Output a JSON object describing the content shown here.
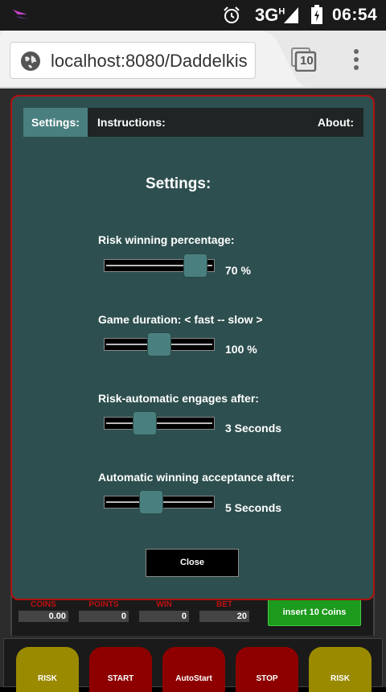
{
  "status_bar": {
    "network": "3G",
    "network_sup": "H",
    "time": "06:54",
    "icons": [
      "app-notification-icon",
      "alarm-icon",
      "signal-icon",
      "battery-charging-icon"
    ]
  },
  "browser": {
    "url": "localhost:8080/Daddelkis",
    "tab_count": "10",
    "icons": [
      "globe-icon",
      "tabs-icon",
      "overflow-menu-icon"
    ]
  },
  "dialog": {
    "nav": {
      "settings": "Settings:",
      "instructions": "Instructions:",
      "about": "About:"
    },
    "title": "Settings:",
    "settings": [
      {
        "label": "Risk winning percentage:",
        "value": "70 %",
        "slider_fraction": 0.92
      },
      {
        "label": "Game duration: < fast -- slow >",
        "value": "100 %",
        "slider_fraction": 0.5
      },
      {
        "label": "Risk-automatic engages after:",
        "value": "3 Seconds",
        "slider_fraction": 0.33
      },
      {
        "label": "Automatic winning acceptance after:",
        "value": "5 Seconds",
        "slider_fraction": 0.41
      }
    ],
    "close_label": "Close"
  },
  "stats": {
    "coins_label": "COINS",
    "coins_value": "0.00",
    "points_label": "POINTS",
    "points_value": "0",
    "win_label": "WIN",
    "win_value": "0",
    "bet_label": "BET",
    "bet_value": "20",
    "insert_label": "insert 10 Coins"
  },
  "game_buttons": {
    "risk_left": "RISK",
    "start": "START",
    "autostart": "AutoStart",
    "stop": "STOP",
    "risk_right": "RISK"
  },
  "colors": {
    "dialog_bg": "#2e4f4f",
    "accent_teal": "#4a7f7f",
    "border_red": "#b01010",
    "insert_green": "#1c9b1c"
  }
}
